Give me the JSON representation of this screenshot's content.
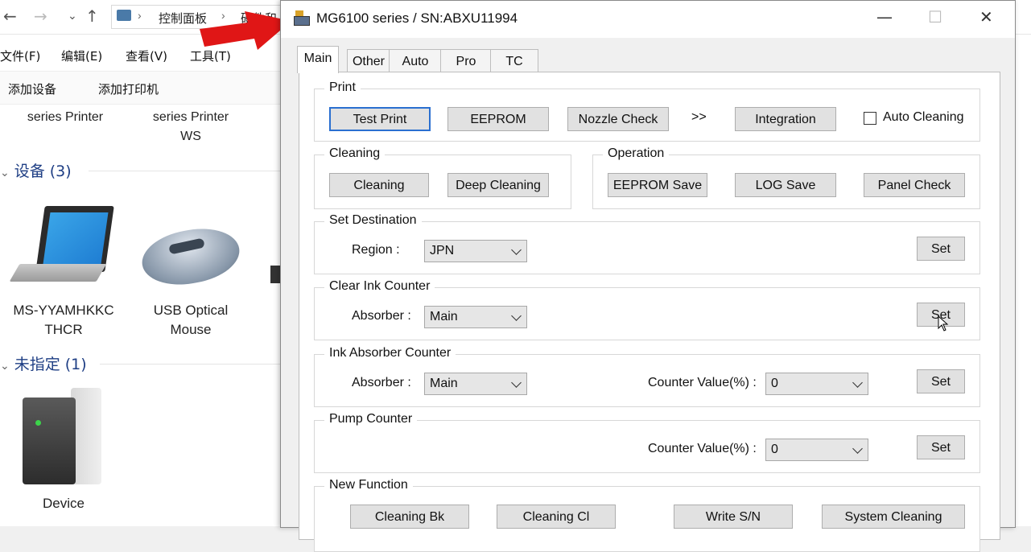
{
  "explorer": {
    "address": {
      "part1": "控制面板",
      "part2": "硬件和"
    },
    "menu": [
      "文件(F)",
      "编辑(E)",
      "查看(V)",
      "工具(T)"
    ],
    "toolbar": [
      "添加设备",
      "添加打印机"
    ],
    "printers": [
      {
        "line1": "series Printer",
        "line2": ""
      },
      {
        "line1": "series Printer",
        "line2": "WS"
      }
    ],
    "devices_header": "设备 (3)",
    "devices": [
      {
        "line1": "MS-YYAMHKKC",
        "line2": "THCR"
      },
      {
        "line1": "USB Optical",
        "line2": "Mouse"
      }
    ],
    "unspecified_header": "未指定 (1)",
    "unspecified_devices": [
      {
        "line1": "Device"
      }
    ]
  },
  "dialog": {
    "title": "MG6100 series / SN:ABXU11994",
    "tabs": [
      "Main",
      "Other",
      "Auto",
      "Pro",
      "TC"
    ],
    "active_tab": "Main",
    "print": {
      "label": "Print",
      "test_print": "Test Print",
      "eeprom": "EEPROM",
      "nozzle_check": "Nozzle Check",
      "more": ">>",
      "integration": "Integration",
      "auto_cleaning": "Auto Cleaning",
      "auto_cleaning_checked": false
    },
    "cleaning": {
      "label": "Cleaning",
      "cleaning": "Cleaning",
      "deep_cleaning": "Deep Cleaning"
    },
    "operation": {
      "label": "Operation",
      "eeprom_save": "EEPROM Save",
      "log_save": "LOG Save",
      "panel_check": "Panel Check"
    },
    "set_destination": {
      "label": "Set Destination",
      "region_label": "Region :",
      "region_value": "JPN",
      "set": "Set"
    },
    "clear_ink_counter": {
      "label": "Clear Ink Counter",
      "absorber_label": "Absorber :",
      "absorber_value": "Main",
      "set": "Set"
    },
    "ink_absorber_counter": {
      "label": "Ink Absorber Counter",
      "absorber_label": "Absorber :",
      "absorber_value": "Main",
      "counter_label": "Counter Value(%) :",
      "counter_value": "0",
      "set": "Set"
    },
    "pump_counter": {
      "label": "Pump Counter",
      "counter_label": "Counter Value(%) :",
      "counter_value": "0",
      "set": "Set"
    },
    "new_function": {
      "label": "New Function",
      "cleaning_bk": "Cleaning Bk",
      "cleaning_cl": "Cleaning Cl",
      "write_sn": "Write S/N",
      "system_cleaning": "System Cleaning"
    }
  }
}
